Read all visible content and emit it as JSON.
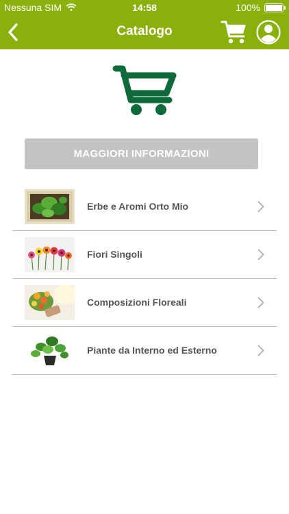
{
  "status_bar": {
    "carrier": "Nessuna SIM",
    "time": "14:58",
    "battery": "100%"
  },
  "nav": {
    "title": "Catalogo"
  },
  "info_button": {
    "label": "MAGGIORI INFORMAZIONI"
  },
  "categories": [
    {
      "label": "Erbe e Aromi Orto Mio"
    },
    {
      "label": "Fiori Singoli"
    },
    {
      "label": "Composizioni Floreali"
    },
    {
      "label": "Piante da Interno ed Esterno"
    }
  ],
  "colors": {
    "brand_green": "#8ab00b",
    "cart_green": "#0f6a3a",
    "button_gray": "#c3c3c3"
  }
}
